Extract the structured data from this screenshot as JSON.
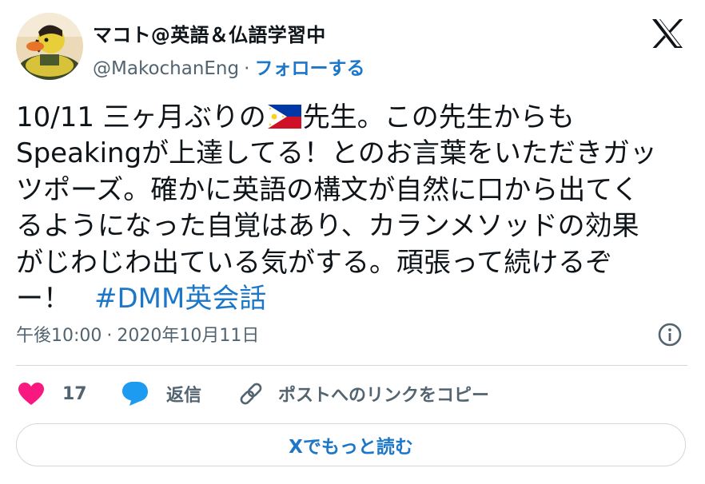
{
  "author": {
    "display_name": "マコト@英語＆仏語学習中",
    "handle": "@MakochanEng",
    "separator": "·",
    "follow_label": "フォローする",
    "avatar_icon": "rubber-duck-avatar"
  },
  "brand": {
    "logo_icon": "x-logo",
    "color": "#0f1419"
  },
  "tweet": {
    "lines": [
      {
        "before_flag": "10/11 三ヶ月ぶりの",
        "flag_icon": "philippines-flag-emoji",
        "after_flag": "先生。この先生からも"
      },
      {
        "text": "Speakingが上達してる！とのお言葉をいただきガッ"
      },
      {
        "text": "ツポーズ。確かに英語の構文が自然に口から出てく"
      },
      {
        "text": "るようになった自覚はあり、カランメソッドの効果"
      },
      {
        "text": "がじわじわ出ている気がする。頑張って続けるぞ"
      },
      {
        "text": "ー！",
        "hashtag": "#DMM英会話"
      }
    ]
  },
  "meta": {
    "time": "午後10:00",
    "separator": "·",
    "date": "2020年10月11日",
    "info_icon": "info-icon"
  },
  "actions": {
    "like_count": "17",
    "like_icon": "heart-icon",
    "reply_label": "返信",
    "reply_icon": "speech-bubble-icon",
    "copy_label": "ポストへのリンクをコピー",
    "copy_icon": "link-icon"
  },
  "read_more_label": "Xでもっと読む",
  "colors": {
    "text": "#0f1419",
    "secondary": "#536471",
    "link": "#1d77c9",
    "like": "#f91880",
    "reply": "#1d9bf0",
    "border": "#cfd9de"
  }
}
